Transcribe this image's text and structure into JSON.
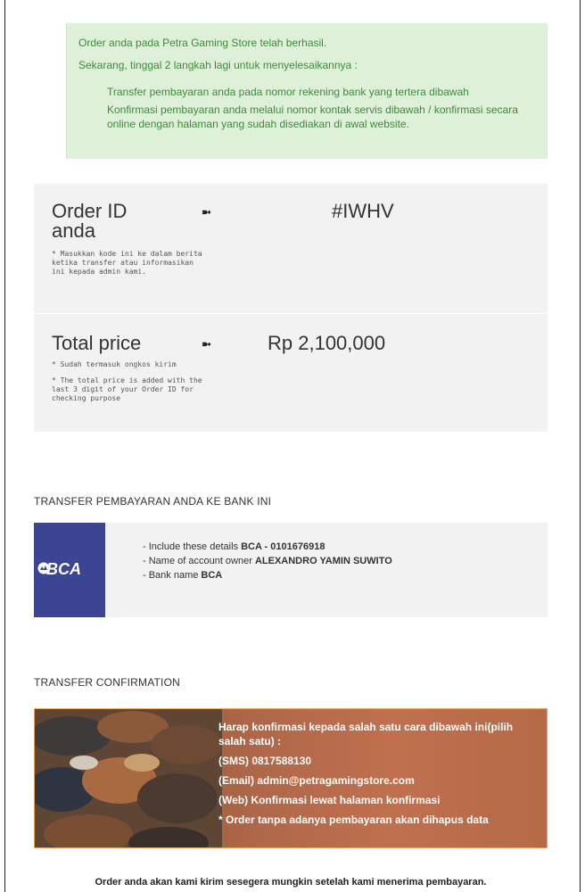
{
  "notice": {
    "line1": "Order anda pada Petra Gaming Store telah berhasil.",
    "line2": "Sekarang, tinggal 2 langkah lagi untuk menyelesaikannya :",
    "steps": [
      "Transfer pembayaran anda pada nomor rekening bank yang tertera dibawah",
      "Konfirmasi pembayaran anda melalui nomor kontak servis dibawah / konfirmasi secara online dengan halaman yang sudah disediakan di awal website."
    ]
  },
  "order": {
    "id_label": "Order ID anda",
    "id_note": "* Masukkan kode ini ke dalam berita ketika transfer atau informasikan ini kepada admin kami.",
    "arrow": "➼",
    "id_value": "#IWHV",
    "price_label": "Total price",
    "price_note1": "* Sudah termasuk ongkos kirim",
    "price_note2": "* The total price is added with the last 3 digit of your Order ID for checking purpose",
    "price_value": "Rp 2,100,000"
  },
  "bank_section": {
    "title": "TRANSFER PEMBAYARAN ANDA KE BANK INI",
    "logo_text": "BCA",
    "line1_prefix": "- Include these details ",
    "line1_bold": "BCA - 0101676918",
    "line2_prefix": "- Name of account owner ",
    "line2_bold": "ALEXANDRO YAMIN SUWITO",
    "line3_prefix": "- Bank name ",
    "line3_bold": "BCA"
  },
  "confirm_section": {
    "title": "TRANSFER CONFIRMATION",
    "lines": [
      "Harap konfirmasi kepada salah satu cara dibawah ini(pilih salah satu) :",
      "(SMS) 0817588130",
      "(Email) admin@petragamingstore.com",
      "(Web) Konfirmasi lewat halaman konfirmasi",
      "* Order tanpa adanya pembayaran akan dihapus data"
    ]
  },
  "footer": {
    "note": "Order anda akan kami kirim sesegera mungkin setelah kami menerima pembayaran."
  },
  "colors": {
    "notice_bg": "#dff0d8",
    "notice_text": "#3c8c3c",
    "bank_blue": "#3c4494",
    "box_gray": "#f2f2f2"
  }
}
